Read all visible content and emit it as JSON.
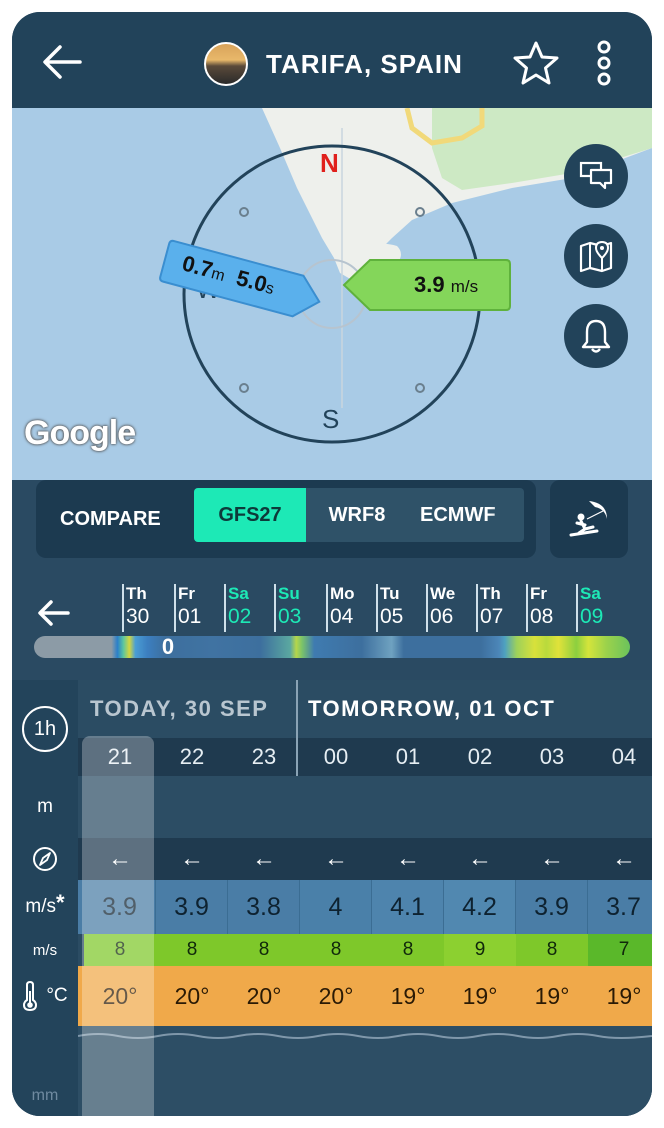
{
  "header": {
    "location": "TARIFA, SPAIN"
  },
  "map": {
    "compass": {
      "n": "N",
      "w": "W",
      "s": "S"
    },
    "wave": {
      "height": "0.7",
      "height_unit": "m",
      "period": "5.0",
      "period_unit": "s"
    },
    "wind": {
      "speed": "3.9",
      "unit": "m/s"
    },
    "google_label": "Google"
  },
  "compare": {
    "label": "COMPARE",
    "models": [
      "GFS27",
      "WRF8",
      "ECMWF"
    ],
    "selected": "GFS27"
  },
  "timeline": {
    "days": [
      {
        "wd": "Th",
        "dn": "30"
      },
      {
        "wd": "Fr",
        "dn": "01"
      },
      {
        "wd": "Sa",
        "dn": "02"
      },
      {
        "wd": "Su",
        "dn": "03"
      },
      {
        "wd": "Mo",
        "dn": "04"
      },
      {
        "wd": "Tu",
        "dn": "05"
      },
      {
        "wd": "We",
        "dn": "06"
      },
      {
        "wd": "Th",
        "dn": "07"
      },
      {
        "wd": "Fr",
        "dn": "08"
      },
      {
        "wd": "Sa",
        "dn": "09"
      }
    ],
    "knob": "0"
  },
  "table": {
    "interval": "1h",
    "today": "TODAY, 30 SEP",
    "tomorrow": "TOMORROW, 01 OCT",
    "hours": [
      "21",
      "22",
      "23",
      "00",
      "01",
      "02",
      "03",
      "04"
    ],
    "row_labels": {
      "wave": "m",
      "wind": "m/s",
      "wind_star": "*",
      "gust": "m/s",
      "temp": "°C",
      "rain": "mm"
    },
    "direction_arrow": "←",
    "wind": [
      "3.9",
      "3.9",
      "3.8",
      "4",
      "4.1",
      "4.2",
      "3.9",
      "3.7"
    ],
    "gust": [
      "8",
      "8",
      "8",
      "8",
      "8",
      "9",
      "8",
      "7"
    ],
    "temp": [
      "20°",
      "20°",
      "20°",
      "20°",
      "19°",
      "19°",
      "19°",
      "19°"
    ]
  },
  "colors": {
    "accent": "#1de9b6",
    "north": "#e0201c",
    "gust_green": "#7ec82a",
    "temp_orange": "#f0a94a"
  }
}
